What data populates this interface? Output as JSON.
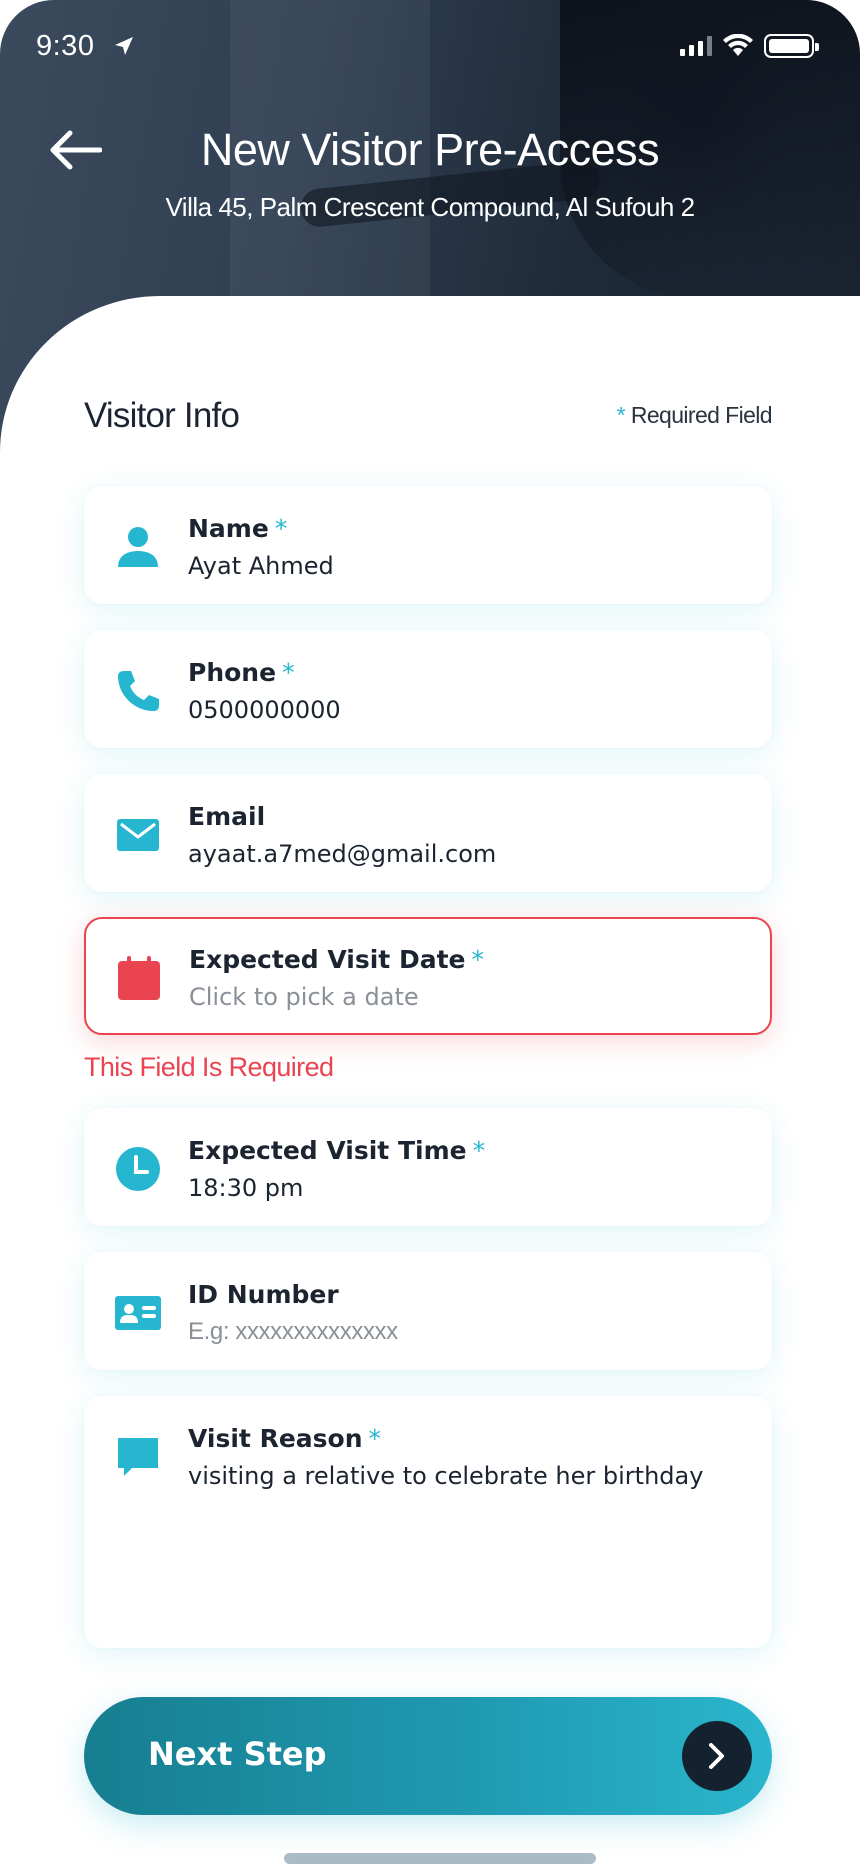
{
  "status_bar": {
    "time": "9:30"
  },
  "header": {
    "title": "New Visitor Pre-Access",
    "subtitle": "Villa 45, Palm Crescent Compound, Al Sufouh 2"
  },
  "form": {
    "section_title": "Visitor Info",
    "required_marker": "*",
    "required_note": "Required Field",
    "fields": [
      {
        "label": "Name",
        "value": "Ayat Ahmed",
        "icon": "person-icon"
      },
      {
        "label": "Phone",
        "value": "0500000000",
        "icon": "phone-icon"
      },
      {
        "label": "Email",
        "value": "ayaat.a7med@gmail.com",
        "icon": "mail-icon"
      },
      {
        "label": "Expected Visit Date",
        "placeholder": "Click to pick a date",
        "icon": "calendar-icon"
      },
      {
        "label": "Expected Visit Time",
        "value": "18:30 pm",
        "icon": "clock-icon"
      },
      {
        "label": "ID Number",
        "placeholder": "E.g: xxxxxxxxxxxxxx",
        "icon": "id-card-icon"
      },
      {
        "label": "Visit Reason",
        "value": "visiting a relative to celebrate her birthday",
        "icon": "chat-icon"
      }
    ],
    "date_error": "This Field Is Required"
  },
  "next_button": {
    "label": "Next Step"
  },
  "colors": {
    "accent": "#26b6cf",
    "error": "#e9444f",
    "text": "#1b2430",
    "button_dark": "#142230"
  }
}
